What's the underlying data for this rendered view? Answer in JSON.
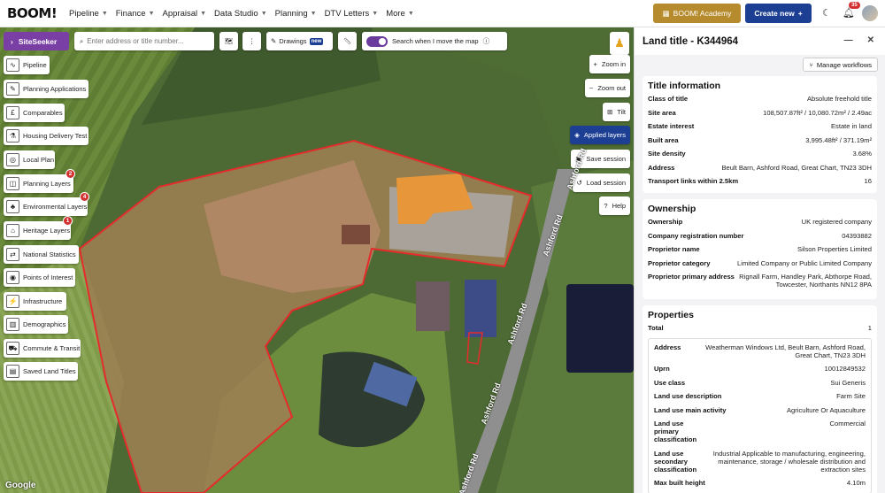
{
  "app": {
    "logo": "BOOM!"
  },
  "nav": [
    {
      "label": "Pipeline"
    },
    {
      "label": "Finance"
    },
    {
      "label": "Appraisal"
    },
    {
      "label": "Data Studio"
    },
    {
      "label": "Planning"
    },
    {
      "label": "DTV Letters"
    },
    {
      "label": "More"
    }
  ],
  "header": {
    "academy": "BOOM! Academy",
    "create": "Create new",
    "notif_count": "35"
  },
  "map": {
    "siteseeker": "SiteSeeker",
    "search_placeholder": "Enter address or title number...",
    "drawings": "Drawings",
    "new_tag": "new",
    "toggle_label": "Search when I move the map",
    "side": [
      {
        "label": "Pipeline",
        "icon": "pipeline-icon"
      },
      {
        "label": "Planning Applications",
        "icon": "planning-icon"
      },
      {
        "label": "Comparables",
        "icon": "pound-icon"
      },
      {
        "label": "Housing Delivery Test",
        "icon": "flask-icon"
      },
      {
        "label": "Local Plan",
        "icon": "local-plan-icon"
      },
      {
        "label": "Planning Layers",
        "icon": "planning-layers-icon",
        "badge": "2"
      },
      {
        "label": "Environmental Layers",
        "icon": "tree-icon",
        "badge": "4"
      },
      {
        "label": "Heritage Layers",
        "icon": "heritage-icon",
        "badge": "1"
      },
      {
        "label": "National Statistics",
        "icon": "stats-icon"
      },
      {
        "label": "Points of Interest",
        "icon": "pin-icon"
      },
      {
        "label": "Infrastructure",
        "icon": "pylon-icon"
      },
      {
        "label": "Demographics",
        "icon": "chart-icon"
      },
      {
        "label": "Commute & Transit",
        "icon": "bus-icon"
      },
      {
        "label": "Saved Land Titles",
        "icon": "saved-icon"
      }
    ],
    "right": {
      "zoom_in": "Zoom in",
      "zoom_out": "Zoom out",
      "tilt": "Tilt",
      "applied": "Applied layers",
      "save": "Save session",
      "load": "Load session",
      "help": "Help"
    },
    "road_label": "Ashford Rd",
    "attribution": "Google"
  },
  "panel": {
    "title": "Land title - K344964",
    "manage": "Manage workflows",
    "title_info": {
      "heading": "Title information",
      "rows": [
        {
          "k": "Class of title",
          "v": "Absolute freehold title"
        },
        {
          "k": "Site area",
          "v": "108,507.87ft² / 10,080.72m² / 2.49ac"
        },
        {
          "k": "Estate interest",
          "v": "Estate in land"
        },
        {
          "k": "Built area",
          "v": "3,995.48ft² / 371.19m²"
        },
        {
          "k": "Site density",
          "v": "3.68%"
        },
        {
          "k": "Address",
          "v": "Beult Barn, Ashford Road, Great Chart, TN23 3DH"
        },
        {
          "k": "Transport links within 2.5km",
          "v": "16"
        }
      ]
    },
    "ownership": {
      "heading": "Ownership",
      "rows": [
        {
          "k": "Ownership",
          "v": "UK registered company"
        },
        {
          "k": "Company registration number",
          "v": "04393882"
        },
        {
          "k": "Proprietor name",
          "v": "Silson Properties Limited"
        },
        {
          "k": "Proprietor category",
          "v": "Limited Company or Public Limited Company"
        },
        {
          "k": "Proprietor primary address",
          "v": "Rignall Farm, Handley Park, Abthorpe Road, Towcester, Northants NN12 8PA"
        }
      ]
    },
    "properties": {
      "heading": "Properties",
      "total_label": "Total",
      "total": "1",
      "rows": [
        {
          "k": "Address",
          "v": "Weatherman Windows Ltd, Beult Barn, Ashford Road, Great Chart, TN23 3DH"
        },
        {
          "k": "Uprn",
          "v": "10012849532"
        },
        {
          "k": "Use class",
          "v": "Sui Generis"
        },
        {
          "k": "Land use description",
          "v": "Farm Site"
        },
        {
          "k": "Land use main activity",
          "v": "Agriculture Or Aquaculture"
        },
        {
          "k": "Land use primary classification",
          "v": "Commercial"
        },
        {
          "k": "Land use secondary classification",
          "v": "Industrial Applicable to manufacturing, engineering, maintenance, storage / wholesale distribution and extraction sites"
        },
        {
          "k": "Max built height",
          "v": "4.10m"
        }
      ]
    }
  }
}
